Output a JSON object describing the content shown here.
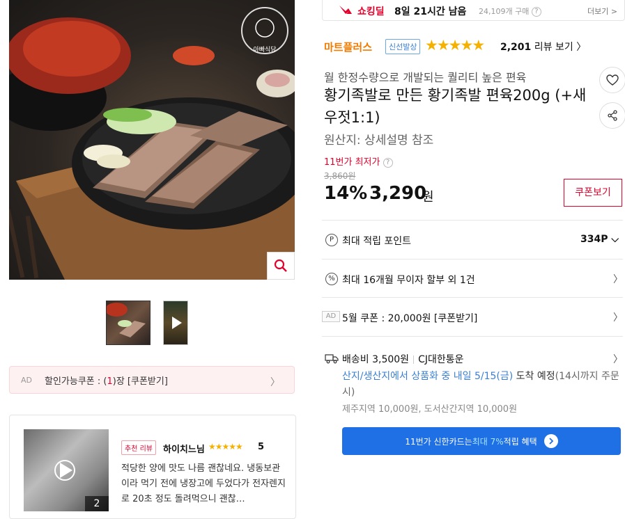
{
  "gallery": {
    "brand_logo_text": "아빠식당",
    "thumbnails": [
      "thumb-food",
      "thumb-video"
    ]
  },
  "coupon_bar": {
    "ad": "AD",
    "prefix": "할인가능쿠폰 : (",
    "count": "1",
    "suffix": ")장 [쿠폰받기]"
  },
  "review": {
    "badge": "추천 리뷰",
    "reviewer": "하이치느님",
    "stars": "★★★★★",
    "score": "5",
    "text": "적당한 양에 맛도 나름 괜찮네요. 냉동보관이라 먹기 전에 냉장고에 두었다가 전자렌지로 20초 정도 돌려먹으니 괜찮…",
    "photo_count": "2"
  },
  "deal": {
    "label": "쇼킹딜",
    "time_left": "8일 21시간 남음",
    "buy_count": "24,109개 구매",
    "more": "더보기 >"
  },
  "product": {
    "seller": "마트플러스",
    "badge": "신선발상",
    "rating": 4.5,
    "review_count": "2,201",
    "review_label": "리뷰 보기",
    "subtitle": "월 한정수량으로 개발되는 퀄리티 높은 편육",
    "title": "황기족발로 만든 황기족발 편육200g (+새우젓1:1)",
    "origin": "원산지:  상세설명 참조"
  },
  "price": {
    "lowest_label": "11번가 최저가",
    "original": "3,860원",
    "discount": "14%",
    "value": "3,290",
    "unit": "원",
    "coupon_button": "쿠폰보기"
  },
  "benefits": {
    "points_label": "최대 적립 포인트",
    "points_value": "334P",
    "installment": "최대 16개월 무이자 할부 외 1건",
    "ad": "AD",
    "coupon": "5월 쿠폰 : 20,000원 [쿠폰받기]"
  },
  "shipping": {
    "fee": "배송비 3,500원",
    "carrier": "CJ대한통운",
    "date_blue": "산지/생산지에서 상품화 중 내일 5/15(금)",
    "date_rest": " 도착 예정",
    "date_note": "(14시까지 주문 시)",
    "extra": "제주지역 10,000원, 도서산간지역 10,000원"
  },
  "card_banner": {
    "prefix": "11번가 신한카드는 ",
    "highlight": "최대 7%",
    "suffix": " 적립 혜택"
  },
  "colors": {
    "brand_red": "#e3002b",
    "seller_orange": "#f47a00",
    "star_gold": "#f5b100",
    "ship_blue": "#3a7fd4",
    "banner_blue": "#1f6fe5"
  }
}
